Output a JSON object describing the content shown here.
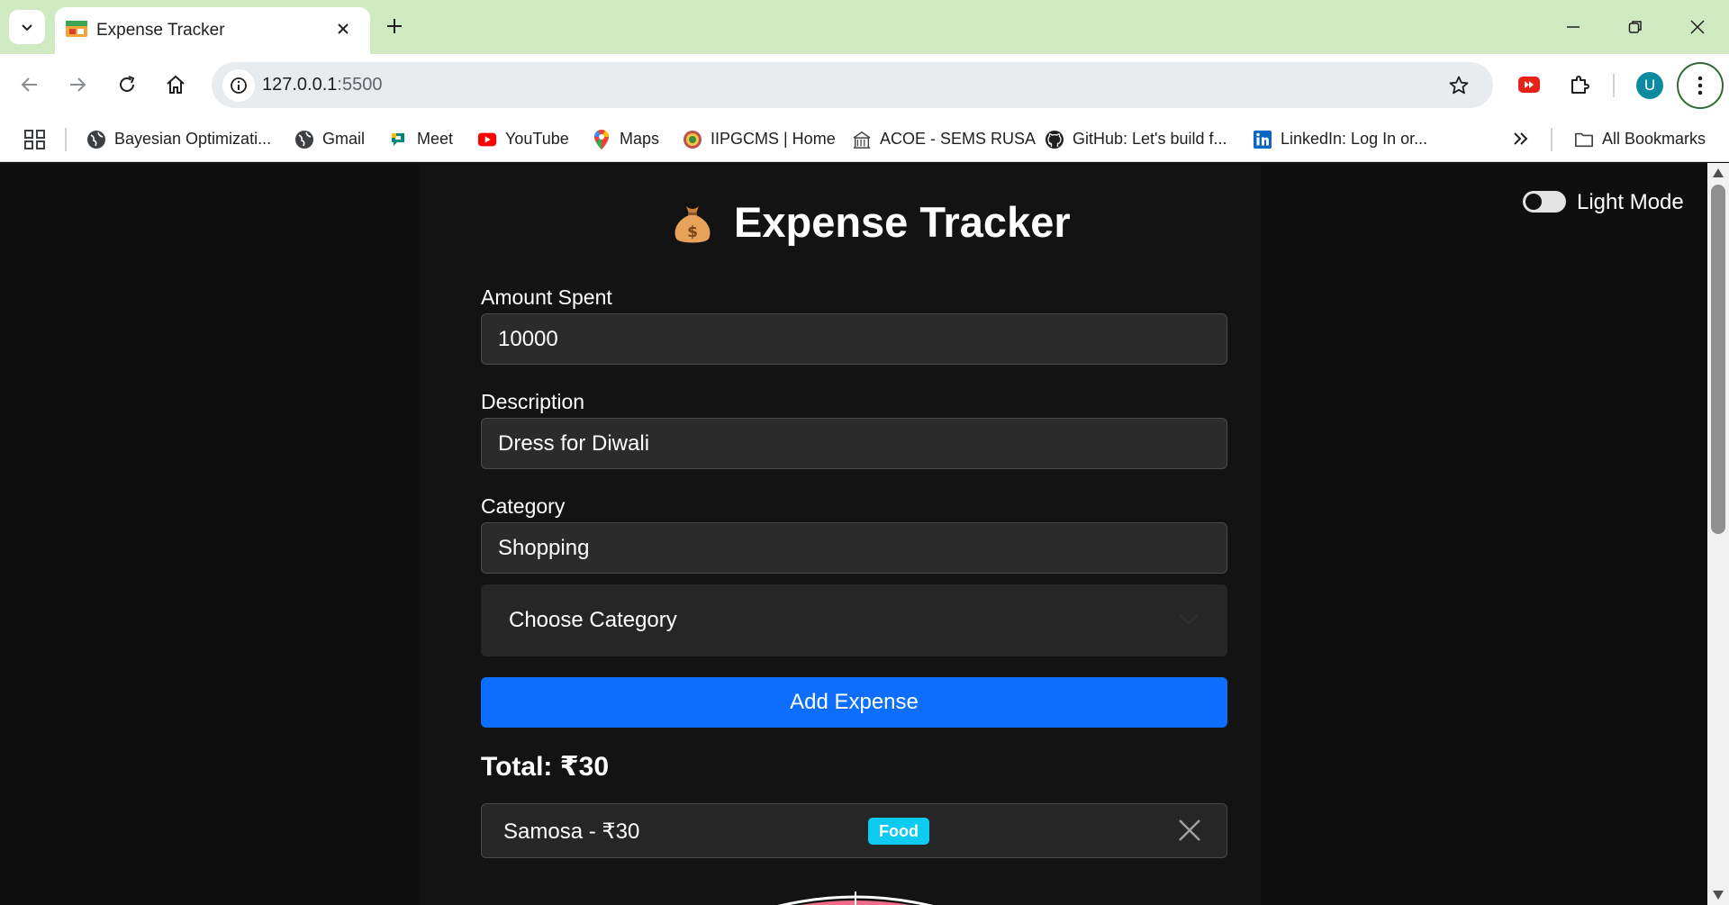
{
  "browser": {
    "tab": {
      "title": "Expense Tracker"
    },
    "address": {
      "host": "127.0.0.1",
      "port": ":5500"
    },
    "profile_initial": "U",
    "bookmarks": [
      {
        "label": "Bayesian Optimizati...",
        "icon": "globe-icon"
      },
      {
        "label": "Gmail",
        "icon": "globe-icon"
      },
      {
        "label": "Meet",
        "icon": "meet-icon"
      },
      {
        "label": "YouTube",
        "icon": "youtube-icon"
      },
      {
        "label": "Maps",
        "icon": "maps-icon"
      },
      {
        "label": "IIPGCMS | Home",
        "icon": "iipgcms-icon"
      },
      {
        "label": "ACOE - SEMS RUSA",
        "icon": "acoe-icon"
      },
      {
        "label": "GitHub: Let's build f...",
        "icon": "github-icon"
      },
      {
        "label": "LinkedIn: Log In or...",
        "icon": "linkedin-icon"
      }
    ],
    "all_bookmarks_label": "All Bookmarks"
  },
  "app": {
    "title": "Expense Tracker",
    "theme_toggle_label": "Light Mode",
    "form": {
      "amount_label": "Amount Spent",
      "amount_value": "10000",
      "description_label": "Description",
      "description_value": "Dress for Diwali",
      "category_label": "Category",
      "category_value": "Shopping",
      "category_select_placeholder": "Choose Category",
      "submit_label": "Add Expense"
    },
    "total_text": "Total: ₹30",
    "expenses": [
      {
        "text": "Samosa - ₹30",
        "category": "Food"
      }
    ]
  },
  "colors": {
    "accent": "#0d6efd",
    "badge_food": "#0dcaf0",
    "page_background": "#0f0f0f",
    "input_background": "#2b2b2b"
  }
}
